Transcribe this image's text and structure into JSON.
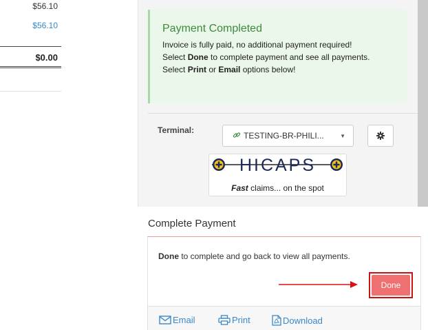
{
  "invoice": {
    "amount_1": "$56.10",
    "amount_2": "$56.10",
    "balance": "$0.00"
  },
  "alert": {
    "title": "Payment Completed",
    "line1": "Invoice is fully paid, no additional payment required!",
    "line2_pre": "Select ",
    "line2_bold": "Done",
    "line2_post": " to complete payment and see all payments.",
    "line3_pre": "Select ",
    "line3_bold1": "Print",
    "line3_mid": " or ",
    "line3_bold2": "Email",
    "line3_post": " options below!"
  },
  "terminal": {
    "label": "Terminal:",
    "selected": "TESTING-BR-PHILI..."
  },
  "hicaps": {
    "logo_text": "HICAPS",
    "tagline_bold": "Fast",
    "tagline_rest": " claims... on the spot"
  },
  "complete": {
    "title": "Complete Payment",
    "instruction_bold": "Done",
    "instruction_rest": " to complete and go back to view all payments.",
    "done_label": "Done"
  },
  "footer": {
    "email_label": "Email",
    "print_label": "Print",
    "download_label": "Download"
  },
  "colors": {
    "success_bg": "#eaf7ea",
    "success_text": "#3c8a3c",
    "link": "#3a87c8",
    "done_button": "#ee7070",
    "highlight": "#cc1111"
  }
}
